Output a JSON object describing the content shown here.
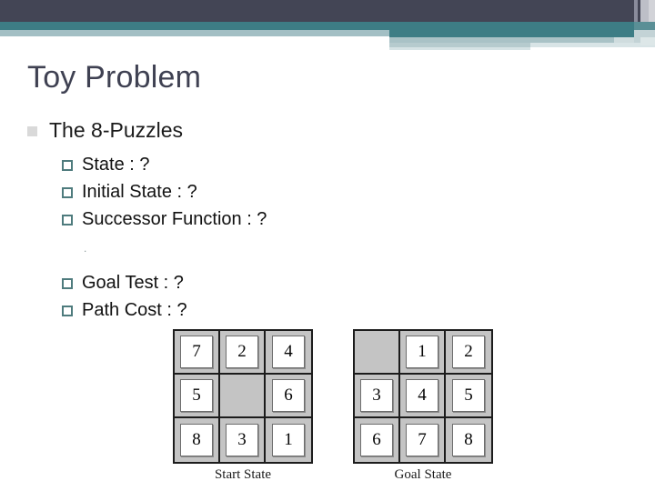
{
  "slide": {
    "title": "Toy Problem",
    "bullet": {
      "text": "The 8-Puzzles",
      "marker": "filled-square-bullet"
    },
    "sub_bullets_top": [
      {
        "text": "State : ?",
        "marker": "hollow-square-bullet"
      },
      {
        "text": "Initial State : ?",
        "marker": "hollow-square-bullet"
      },
      {
        "text": "Successor Function : ?",
        "marker": "hollow-square-bullet"
      }
    ],
    "spacer_mark": ".",
    "sub_bullets_bottom": [
      {
        "text": "Goal Test : ?",
        "marker": "hollow-square-bullet"
      },
      {
        "text": "Path Cost : ?",
        "marker": "hollow-square-bullet"
      }
    ]
  },
  "figure": {
    "start": {
      "caption": "Start State",
      "rows": [
        [
          "7",
          "2",
          "4"
        ],
        [
          "5",
          "",
          "6"
        ],
        [
          "8",
          "3",
          "1"
        ]
      ]
    },
    "goal": {
      "caption": "Goal State",
      "rows": [
        [
          "",
          "1",
          "2"
        ],
        [
          "3",
          "4",
          "5"
        ],
        [
          "6",
          "7",
          "8"
        ]
      ]
    }
  },
  "colors": {
    "header_navy": "#434555",
    "header_teal": "#3d7d85",
    "header_light": "#a3bfc4",
    "title_text": "#3f4152",
    "sub_bullet_marker": "#4e7b7d",
    "grid_background": "#c4c4c4",
    "grid_border": "#1c1c1c",
    "tile_fill": "#ffffff"
  }
}
